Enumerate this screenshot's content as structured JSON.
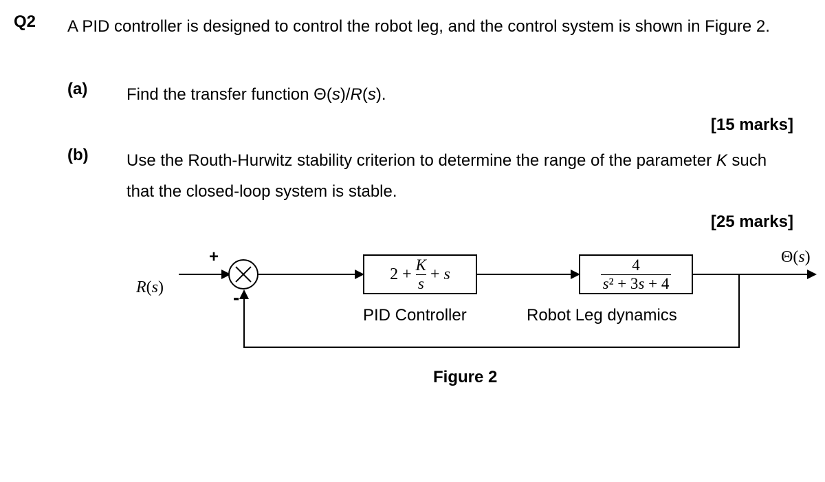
{
  "question": {
    "number": "Q2",
    "prompt": "A PID controller is designed to control the robot leg, and the control system is shown in Figure 2."
  },
  "parts": {
    "a": {
      "label": "(a)",
      "text": "Find the transfer function Θ(s)/R(s).",
      "marks": "[15 marks]"
    },
    "b": {
      "label": "(b)",
      "text": "Use the Routh-Hurwitz stability criterion to determine the range of the parameter K such that the closed-loop system is stable.",
      "marks": "[25 marks]"
    }
  },
  "diagram": {
    "input_label": "R(s)",
    "output_label": "Θ(s)",
    "plus": "+",
    "minus": "-",
    "pid": {
      "two_plus": "2 +",
      "K": "K",
      "s_den": "s",
      "plus_s": "+ s",
      "caption": "PID Controller"
    },
    "plant": {
      "num": "4",
      "den": "s² + 3s + 4",
      "caption": "Robot Leg dynamics"
    },
    "figure_caption": "Figure 2"
  }
}
